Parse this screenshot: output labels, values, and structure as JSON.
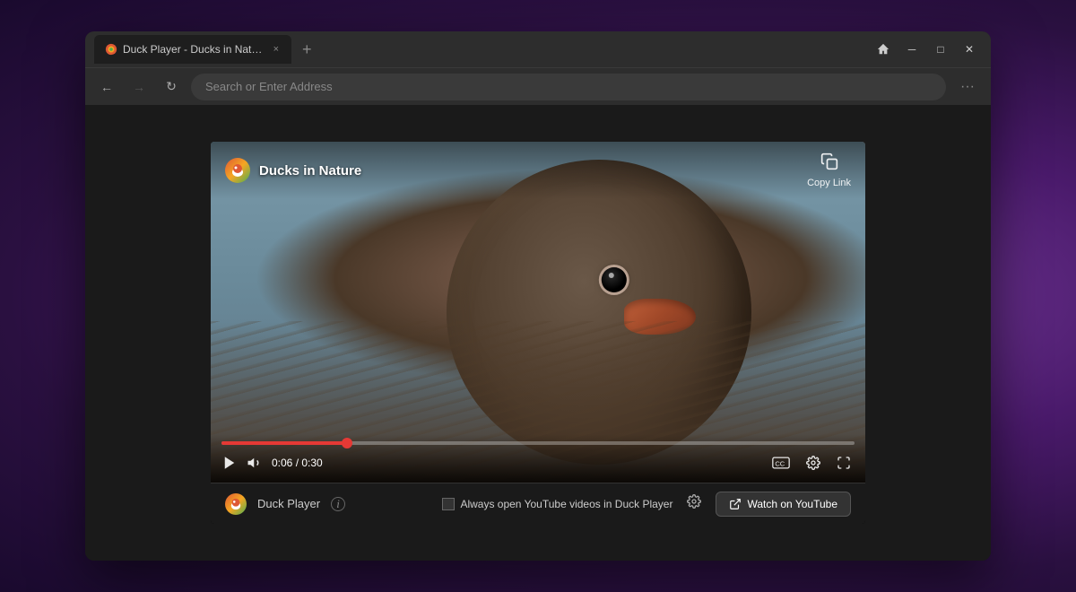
{
  "browser": {
    "tab": {
      "favicon": "🦆",
      "title": "Duck Player - Ducks in Nature...",
      "close_label": "×"
    },
    "new_tab_label": "+",
    "window_controls": {
      "home_label": "⌂",
      "minimize_label": "─",
      "maximize_label": "□",
      "close_label": "✕"
    },
    "nav": {
      "back_label": "←",
      "forward_label": "→",
      "reload_label": "↻",
      "address_placeholder": "Search or Enter Address",
      "menu_label": "···"
    }
  },
  "player": {
    "title": "Ducks in Nature",
    "copy_link_label": "Copy Link",
    "progress_percent": 20,
    "time_current": "0:06",
    "time_total": "0:30",
    "play_label": "▶",
    "volume_label": "🔊",
    "cc_label": "CC",
    "settings_label": "⚙",
    "fullscreen_label": "⛶",
    "bottom": {
      "duck_player_label": "Duck Player",
      "info_label": "i",
      "checkbox_label": "Always open YouTube videos in Duck Player",
      "settings_label": "⚙",
      "watch_btn_icon": "↗",
      "watch_btn_label": "Watch on YouTube"
    }
  }
}
